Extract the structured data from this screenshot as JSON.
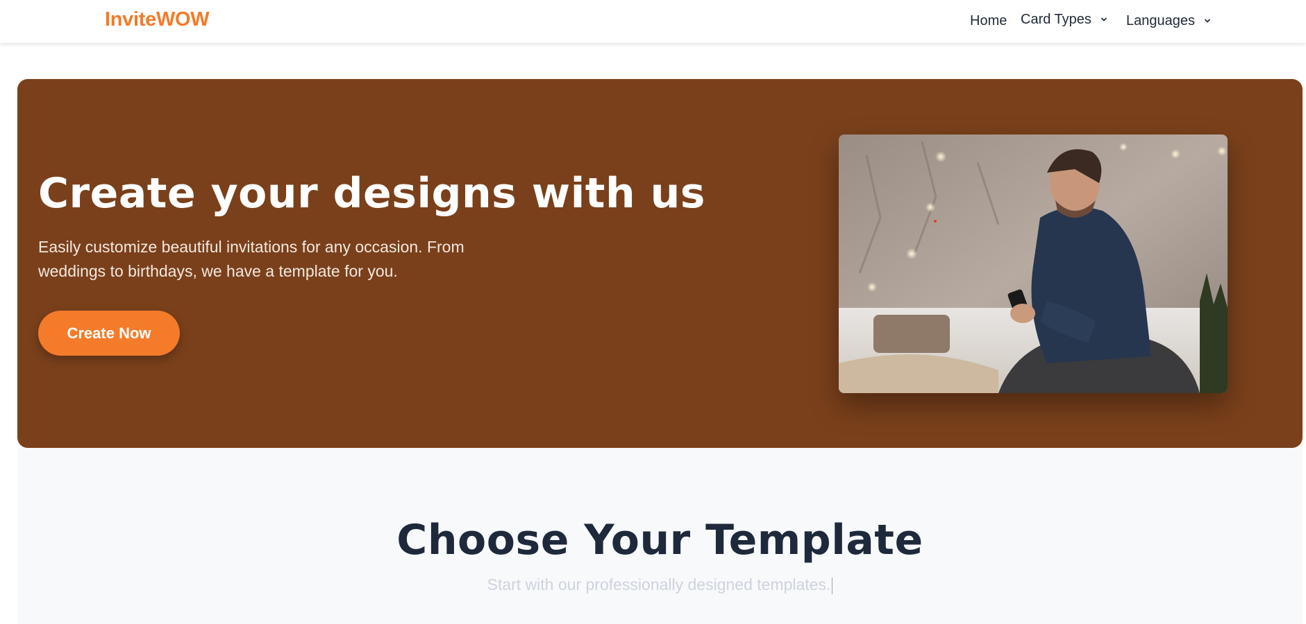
{
  "header": {
    "logo": "InviteWOW",
    "nav": {
      "home": "Home",
      "card_types": "Card Types",
      "languages": "Languages"
    }
  },
  "hero": {
    "title": "Create your designs with us",
    "subtitle": "Easily customize beautiful invitations for any occasion. From weddings to birthdays, we have a template for you.",
    "cta_label": "Create Now",
    "image": "man-with-phone-photo"
  },
  "templates": {
    "title": "Choose Your Template",
    "subtitle": "Start with our professionally designed templates."
  },
  "colors": {
    "brand": "#f47b2a",
    "hero_bg": "#7a401b",
    "heading_dark": "#1e293b"
  }
}
